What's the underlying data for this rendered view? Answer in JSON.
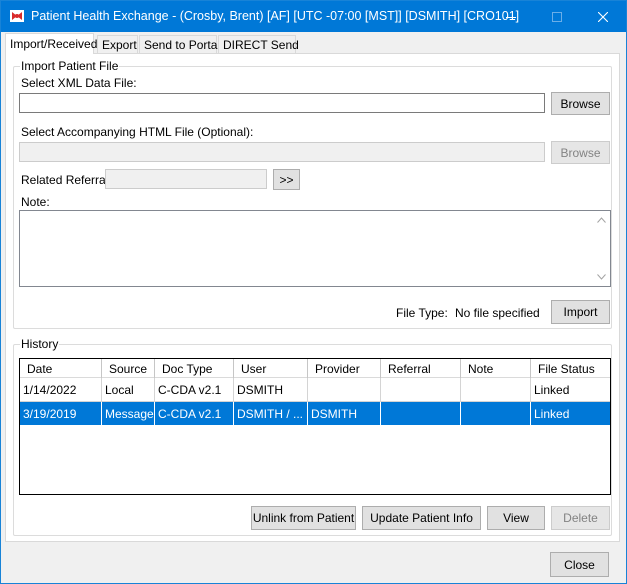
{
  "window": {
    "title": "Patient Health Exchange - (Crosby, Brent) [AF] [UTC -07:00 [MST]] [DSMITH] [CRO101]"
  },
  "tabs": [
    {
      "label": "Import/Received",
      "active": true
    },
    {
      "label": "Export",
      "active": false
    },
    {
      "label": "Send to Portal",
      "active": false
    },
    {
      "label": "DIRECT Send",
      "active": false
    }
  ],
  "import": {
    "group_title": "Import Patient File",
    "xml_label": "Select XML Data File:",
    "xml_value": "",
    "browse_label": "Browse",
    "html_label": "Select Accompanying HTML File (Optional):",
    "html_value": "",
    "browse2_label": "Browse",
    "referral_label": "Related Referral:",
    "referral_value": "",
    "referral_button": ">>",
    "note_label": "Note:",
    "note_value": "",
    "file_type_label": "File Type:",
    "file_type_value": "No file specified",
    "import_button": "Import"
  },
  "history": {
    "group_title": "History",
    "columns": [
      "Date",
      "Source",
      "Doc Type",
      "User",
      "Provider",
      "Referral",
      "Note",
      "File Status"
    ],
    "rows": [
      {
        "date": "1/14/2022",
        "source": "Local",
        "doc_type": "C-CDA v2.1",
        "user": "DSMITH",
        "provider": "",
        "referral": "",
        "note": "",
        "status": "Linked",
        "selected": false
      },
      {
        "date": "3/19/2019",
        "source": "Message",
        "doc_type": "C-CDA v2.1",
        "user": "DSMITH / ...",
        "provider": "DSMITH",
        "referral": "",
        "note": "",
        "status": "Linked",
        "selected": true
      }
    ],
    "buttons": {
      "unlink": "Unlink from Patient",
      "update": "Update Patient Info",
      "view": "View",
      "delete": "Delete"
    }
  },
  "footer": {
    "close_button": "Close"
  },
  "colors": {
    "titlebar": "#0078d7",
    "selection": "#0078d7",
    "app_icon": "#d92b2b"
  },
  "icons": [
    "app-icon",
    "minimize-icon",
    "maximize-icon",
    "close-icon",
    "scroll-up-arrow-icon",
    "scroll-down-arrow-icon"
  ]
}
